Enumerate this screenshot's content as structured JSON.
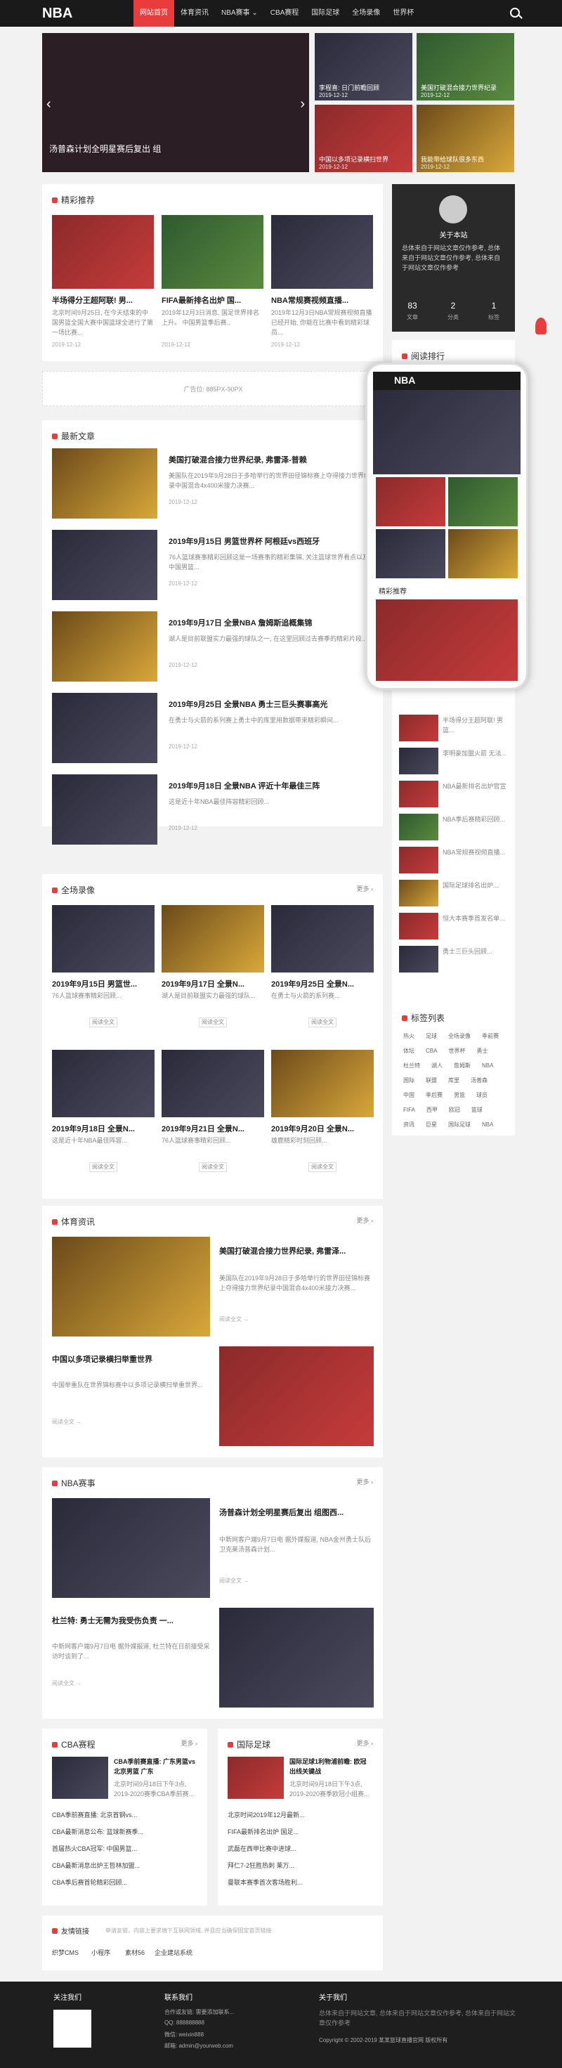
{
  "header": {
    "logo": "NBA",
    "nav": [
      "网站首页",
      "体育资讯",
      "NBA赛事 ⌄",
      "CBA赛程",
      "国际足球",
      "全场录像",
      "世界杯"
    ]
  },
  "slider": {
    "caption": "汤普森计划全明星赛后复出 组"
  },
  "side_thumbs": [
    {
      "title": "李程喜: 日门前瞻回顾",
      "date": "2019-12-12"
    },
    {
      "title": "美国打破混合接力世界纪录",
      "date": "2019-12-12"
    },
    {
      "title": "中国以多项记录横扫世界",
      "date": "2019-12-12"
    },
    {
      "title": "我能带给球队很多东西",
      "date": "2019-12-12"
    }
  ],
  "featured": {
    "title": "精彩推荐",
    "items": [
      {
        "title": "半场得分王超阿联! 男...",
        "desc": "北京时间9月25日, 在今天结束的中国男篮全国大赛中国篮球全进行了第一场比赛...",
        "date": "2019-12-12"
      },
      {
        "title": "FIFA最新排名出炉 国...",
        "desc": "2019年12月3日消息, 国足世界排名上升。 中国男篮季后赛..",
        "date": "2019-12-12"
      },
      {
        "title": "NBA常规赛视频直播...",
        "desc": "2019年12月3日NBA常规赛视频直播已经开始, 你能在比赛中看到精彩球员...",
        "date": "2019-12-12"
      }
    ]
  },
  "profile": {
    "name": "关于本站",
    "desc": "总体来自于网站文章仅作参考, 总体来自于网站文章仅作参考, 总体来自于网站文章仅作参考",
    "stats": [
      "83",
      "2",
      "1"
    ],
    "labels": [
      "文章",
      "分类",
      "标签"
    ]
  },
  "reading_rank": "阅读排行",
  "ad": "广告位: 885PX-90PX",
  "latest": {
    "title": "最新文章",
    "items": [
      {
        "title": "美国打破混合接力世界纪录, 弗雷泽-普赖",
        "desc": "美国队在2019年9月28日于多哈举行的世界田径锦标赛上夺得接力世界纪录中国混合4x400米接力决赛...",
        "date": "2019-12-12"
      },
      {
        "title": "2019年9月15日 男篮世界杯 阿根廷vs西班牙",
        "desc": "76人篮球赛事精彩回顾这是一场赛事的精彩集锦, 关注篮球世界看点以及中国男篮...",
        "date": "2019-12-12"
      },
      {
        "title": "2019年9月17日 全景NBA 詹姆斯追概集锦",
        "desc": "湖人是目前联盟实力最强的球队之一, 在这里回顾过去赛季的精彩片段...",
        "date": "2019-12-12"
      },
      {
        "title": "2019年9月25日 全景NBA 勇士三巨头赛事高光",
        "desc": "在勇士与火箭的系列赛上勇士中的库里用数据带来精彩瞬间...",
        "date": "2019-12-12"
      },
      {
        "title": "2019年9月18日 全景NBA 评近十年最佳三阵",
        "desc": "这是近十年NBA最佳阵容精彩回顾...",
        "date": "2019-12-12"
      }
    ]
  },
  "videos": {
    "title": "全场录像",
    "more": "更多 ›",
    "items": [
      {
        "title": "2019年9月15日 男篮世...",
        "desc": "76人篮球赛事精彩回顾...",
        "btn": "阅读全文"
      },
      {
        "title": "2019年9月17日 全景N...",
        "desc": "湖人是目前联盟实力最强的球队...",
        "btn": "阅读全文"
      },
      {
        "title": "2019年9月25日 全景N...",
        "desc": "在勇士与火箭的系列赛...",
        "btn": "阅读全文"
      },
      {
        "title": "2019年9月18日 全景N...",
        "desc": "这是近十年NBA最佳阵容...",
        "btn": "阅读全文"
      },
      {
        "title": "2019年9月21日 全景N...",
        "desc": "76人篮球赛事精彩回顾...",
        "btn": "阅读全文"
      },
      {
        "title": "2019年9月20日 全景N...",
        "desc": "雄鹿精彩时刻回顾...",
        "btn": "阅读全文"
      }
    ]
  },
  "sports": {
    "title": "体育资讯",
    "more": "更多 ›",
    "a": {
      "title": "美国打破混合接力世界纪录, 弗雷泽...",
      "desc": "美国队在2019年9月28日于多哈举行的世界田径锦标赛上夺得接力世界纪录中国混合4x400米接力决赛...",
      "btn": "阅读全文 →"
    },
    "b": {
      "title": "中国以多项记录横扫举重世界",
      "desc": "中国举重队在世界锦标赛中以多项记录横扫举重世界...",
      "btn": "阅读全文 →"
    }
  },
  "nba": {
    "title": "NBA赛事",
    "more": "更多 ›",
    "a": {
      "title": "汤普森计划全明星赛后复出 组图西...",
      "desc": "中新网客户端9月7日电 据外媒报道, NBA金州勇士队后卫克莱汤普森计划...",
      "btn": "阅读全文 →"
    },
    "b": {
      "title": "杜兰特: 勇士无需为我受伤负责 一...",
      "desc": "中新网客户端9月7日电 据外媒报道, 杜兰特在日前接受采访时谈到了...",
      "btn": "阅读全文 →"
    }
  },
  "cba": {
    "title": "CBA赛程",
    "more": "更多 ›",
    "head": {
      "title": "CBA季前赛直播: 广东男篮vs北京男篮 广东",
      "desc": "北京时间9月18日下午3点, 2019-2020赛季CBA季前赛..."
    },
    "list": [
      "CBA季前赛直播: 北京首钢vs...",
      "CBA最新消息公布: 篮球新赛季...",
      "首届热火CBA冠军: 中国男篮...",
      "CBA最新消息出炉王哲林加盟...",
      "CBA季后赛首轮精彩回顾..."
    ]
  },
  "soccer": {
    "title": "国际足球",
    "more": "更多 ›",
    "head": {
      "title": "国际足球1利物浦前瞻: 欧冠出线关键战",
      "desc": "北京时间9月18日下午3点, 2019-2020赛季欧冠小组赛..."
    },
    "list": [
      "北京时间2019年12月最新...",
      "FIFA最新排名出炉 国足...",
      "武磊在西甲比赛中进球...",
      "拜仁7-2狂胜热刺 莱万...",
      "曼联本赛季首次客场胜利..."
    ]
  },
  "tags": {
    "title": "标签列表",
    "items": [
      "热火",
      "足球",
      "全场录像",
      "季前赛",
      "体坛",
      "CBA",
      "世界杯",
      "勇士",
      "杜兰特",
      "湖人",
      "詹姆斯",
      "NBA",
      "国际",
      "联盟",
      "库里",
      "汤普森",
      "中国",
      "季后赛",
      "男篮",
      "球员",
      "FIFA",
      "西甲",
      "欧冠",
      "篮球",
      "资讯",
      "巨星",
      "国际足球",
      "NBA"
    ]
  },
  "links": {
    "title": "友情链接",
    "note": "申请友链，内容上要求填下互联网领域, 并且应当确保固定首页链接",
    "items": [
      "织梦CMS",
      "小程序",
      "素材56",
      "企业建站系统"
    ]
  },
  "footer": {
    "col1": "关注我们",
    "col2": "联系我们",
    "contact": [
      "合作或友链: 需要添加联系...",
      "QQ: 888888888",
      "微信: weixin888",
      "邮箱: admin@yourweb.com"
    ],
    "col3": "关于我们",
    "about": "总体来自于网站文章, 总体来自于网站文章仅作参考, 总体来自于网站文章仅作参考",
    "copyright": "Copyright © 2002-2019 某某篮球直播官网 版权所有"
  },
  "sidebar_news": [
    "半场得分王超阿联! 男篮...",
    "李明豪加盟火箭 无法...",
    "NBA最新排名出炉官宣",
    "NBA季后赛精彩回顾...",
    "NBA常规赛视频直播...",
    "国际足球排名出炉...",
    "恒大本赛季首发名单...",
    "勇士三巨头回顾..."
  ]
}
